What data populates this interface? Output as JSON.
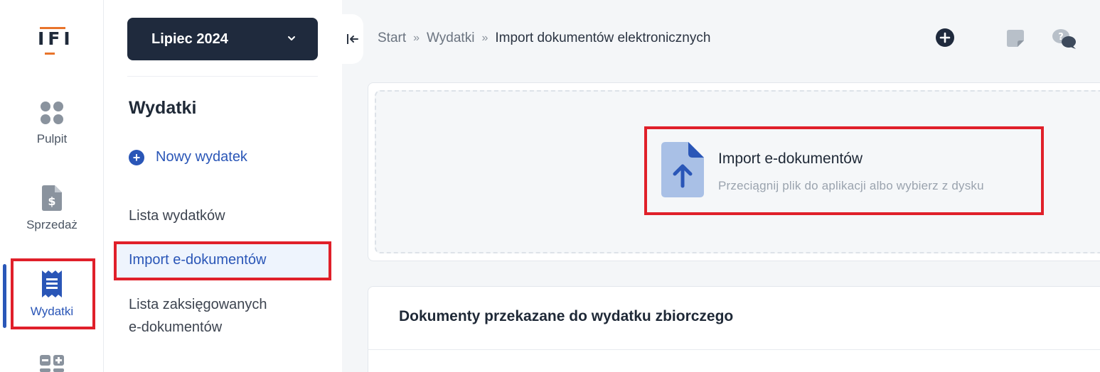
{
  "logo": {
    "text": "IFI"
  },
  "rail": {
    "items": [
      {
        "label": "Pulpit",
        "icon": "dashboard-dots-icon"
      },
      {
        "label": "Sprzedaż",
        "icon": "sales-document-dollar-icon"
      },
      {
        "label": "Wydatki",
        "icon": "receipt-icon",
        "active": true
      },
      {
        "label": "",
        "icon": "calculator-icon"
      }
    ]
  },
  "sidebar": {
    "month_selector": "Lipiec 2024",
    "title": "Wydatki",
    "new_expense": "Nowy wydatek",
    "links": [
      {
        "label": "Lista wydatków"
      },
      {
        "label": "Import e-dokumentów",
        "active": true
      },
      {
        "label_line1": "Lista zaksięgowanych",
        "label_line2": "e-dokumentów"
      }
    ]
  },
  "breadcrumb": [
    "Start",
    "Wydatki",
    "Import dokumentów elektronicznych"
  ],
  "breadcrumb_separator": "»",
  "top_icons": [
    "add-circle-icon",
    "note-icon",
    "help-chat-icon"
  ],
  "import": {
    "title": "Import e-dokumentów",
    "subtitle": "Przeciągnij plik do aplikacji albo wybierz z dysku"
  },
  "section": {
    "title": "Dokumenty przekazane do wydatku zbiorczego"
  },
  "colors": {
    "accent": "#2a56b7",
    "highlight": "#e0202a",
    "dark": "#1f2a3d",
    "logo_accent": "#e8742b"
  }
}
